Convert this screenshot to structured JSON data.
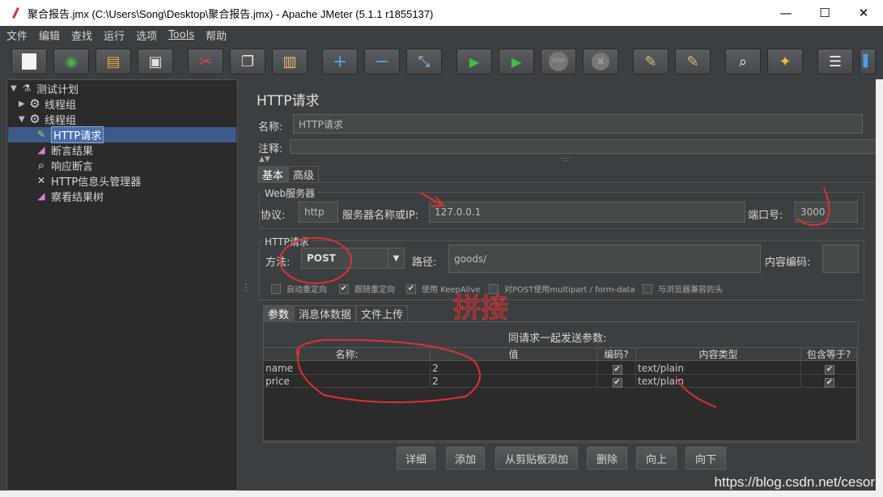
{
  "window": {
    "title": "聚合报告.jmx (C:\\Users\\Song\\Desktop\\聚合报告.jmx) - Apache JMeter (5.1.1 r1855137)",
    "minimize": "—",
    "maximize": "☐",
    "close": "✕"
  },
  "menu": [
    "文件",
    "编辑",
    "查找",
    "运行",
    "选项",
    "Tools",
    "帮助"
  ],
  "toolbar": [
    {
      "icon": "new-icon",
      "glyph": "▫"
    },
    {
      "icon": "templates-icon",
      "glyph": "◉"
    },
    {
      "icon": "open-icon",
      "glyph": "▤"
    },
    {
      "icon": "save-icon",
      "glyph": "▣"
    },
    {
      "icon": "cut-icon",
      "glyph": "✂"
    },
    {
      "icon": "copy-icon",
      "glyph": "❐"
    },
    {
      "icon": "paste-icon",
      "glyph": "▥"
    },
    {
      "icon": "expand-icon",
      "glyph": "+"
    },
    {
      "icon": "collapse-icon",
      "glyph": "−"
    },
    {
      "icon": "toggle-icon",
      "glyph": "⤡"
    },
    {
      "icon": "start-icon",
      "glyph": "▶"
    },
    {
      "icon": "start-no-pause-icon",
      "glyph": "▶"
    },
    {
      "icon": "stop-icon",
      "glyph": "STOP"
    },
    {
      "icon": "shutdown-icon",
      "glyph": "✖"
    },
    {
      "icon": "clear-icon",
      "glyph": "✎"
    },
    {
      "icon": "clear-all-icon",
      "glyph": "✎"
    },
    {
      "icon": "search-icon",
      "glyph": "⌕"
    },
    {
      "icon": "reset-search-icon",
      "glyph": "✦"
    },
    {
      "icon": "function-helper-icon",
      "glyph": "☰"
    }
  ],
  "tree": [
    {
      "label": "测试计划",
      "icon": "test-plan-icon",
      "glyph": "⚗",
      "arrow": "▼",
      "indent": 0
    },
    {
      "label": "线程组",
      "icon": "thread-group-icon",
      "glyph": "⚙",
      "arrow": "▶",
      "indent": 1
    },
    {
      "label": "线程组",
      "icon": "thread-group-icon",
      "glyph": "⚙",
      "arrow": "▼",
      "indent": 1
    },
    {
      "label": "HTTP请求",
      "icon": "http-sampler-icon",
      "glyph": "✎",
      "arrow": "",
      "indent": 2,
      "selected": true
    },
    {
      "label": "断言结果",
      "icon": "chart-icon",
      "glyph": "◢",
      "arrow": "",
      "indent": 2
    },
    {
      "label": "响应断言",
      "icon": "magnifier-icon",
      "glyph": "⌕",
      "arrow": "",
      "indent": 2
    },
    {
      "label": "HTTP信息头管理器",
      "icon": "tools-icon",
      "glyph": "✕",
      "arrow": "",
      "indent": 2
    },
    {
      "label": "察看结果树",
      "icon": "chart-icon",
      "glyph": "◢",
      "arrow": "",
      "indent": 2
    }
  ],
  "panel": {
    "title": "HTTP请求",
    "name_label": "名称:",
    "name_value": "HTTP请求",
    "comment_label": "注释:",
    "tabs": [
      "基本",
      "高级"
    ],
    "web_server": {
      "title": "Web服务器",
      "protocol_label": "协议:",
      "protocol": "http",
      "server_label": "服务器名称或IP:",
      "server": "127.0.0.1",
      "port_label": "端口号:",
      "port": "3000"
    },
    "http_request": {
      "title": "HTTP请求",
      "method_label": "方法:",
      "method": "POST",
      "path_label": "路径:",
      "path": "goods/",
      "encoding_label": "内容编码:",
      "encoding": "",
      "options": [
        {
          "label": "自动重定向",
          "checked": false
        },
        {
          "label": "跟随重定向",
          "checked": true
        },
        {
          "label": "使用 KeepAlive",
          "checked": true
        },
        {
          "label": "对POST使用multipart / form-data",
          "checked": false
        },
        {
          "label": "与浏览器兼容的头",
          "checked": false
        }
      ]
    },
    "sub_tabs": [
      "参数",
      "消息体数据",
      "文件上传"
    ],
    "params_caption": "同请求一起发送参数:",
    "table": {
      "columns": [
        "名称:",
        "值",
        "编码?",
        "内容类型",
        "包含等于?"
      ],
      "rows": [
        {
          "name": "name",
          "value": "2",
          "encode": true,
          "content_type": "text/plain",
          "include_equals": true
        },
        {
          "name": "price",
          "value": "2",
          "encode": true,
          "content_type": "text/plain",
          "include_equals": true
        }
      ]
    },
    "buttons": [
      "详细",
      "添加",
      "从剪贴板添加",
      "删除",
      "向上",
      "向下"
    ]
  },
  "annotation_text": "拼接",
  "watermark": "https://blog.csdn.net/cesor"
}
